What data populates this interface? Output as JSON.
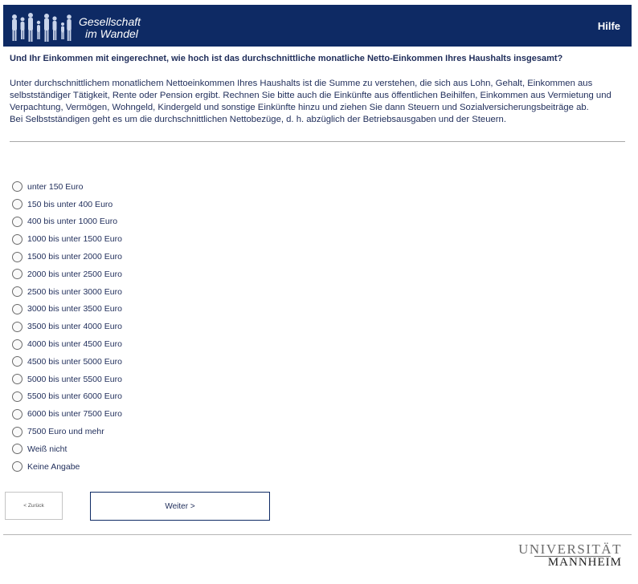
{
  "header": {
    "logo_line1": "Gesellschaft",
    "logo_line2": "im Wandel",
    "help_label": "Hilfe",
    "colors": {
      "bar": "#0e2a64",
      "text": "#ffffff"
    }
  },
  "question": "Und Ihr Einkommen mit eingerechnet, wie hoch ist das durchschnittliche monatliche Netto-Einkommen Ihres Haushalts insgesamt?",
  "explanation": {
    "para1": "Unter durchschnittlichem monatlichem Nettoeinkommen Ihres Haushalts ist die Summe zu verstehen, die sich aus Lohn, Gehalt, Einkommen aus selbstständiger Tätigkeit, Rente oder Pension ergibt. Rechnen Sie bitte auch die Einkünfte aus öffentlichen Beihilfen, Einkommen aus Vermietung und Verpachtung, Vermögen, Wohngeld, Kindergeld und sonstige Einkünfte hinzu und ziehen Sie dann Steuern und Sozialversicherungsbeiträge ab.",
    "para2": "Bei Selbstständigen geht es um die durchschnittlichen Nettobezüge, d. h. abzüglich der Betriebsausgaben und der Steuern."
  },
  "options": [
    "unter 150 Euro",
    "150 bis unter 400 Euro",
    "400 bis unter 1000 Euro",
    "1000 bis unter 1500 Euro",
    "1500 bis unter 2000 Euro",
    "2000 bis unter 2500 Euro",
    "2500 bis unter 3000 Euro",
    "3000 bis unter 3500 Euro",
    "3500 bis unter 4000 Euro",
    "4000 bis unter 4500 Euro",
    "4500 bis unter 5000 Euro",
    "5000 bis unter 5500 Euro",
    "5500 bis unter 6000 Euro",
    "6000 bis unter 7500 Euro",
    "7500 Euro und mehr",
    "Weiß nicht",
    "Keine Angabe"
  ],
  "nav": {
    "back_label": "< Zurück",
    "next_label": "Weiter >"
  },
  "footer": {
    "university_line1": "UNIVERSITÄT",
    "university_line2": "MANNHEIM"
  }
}
